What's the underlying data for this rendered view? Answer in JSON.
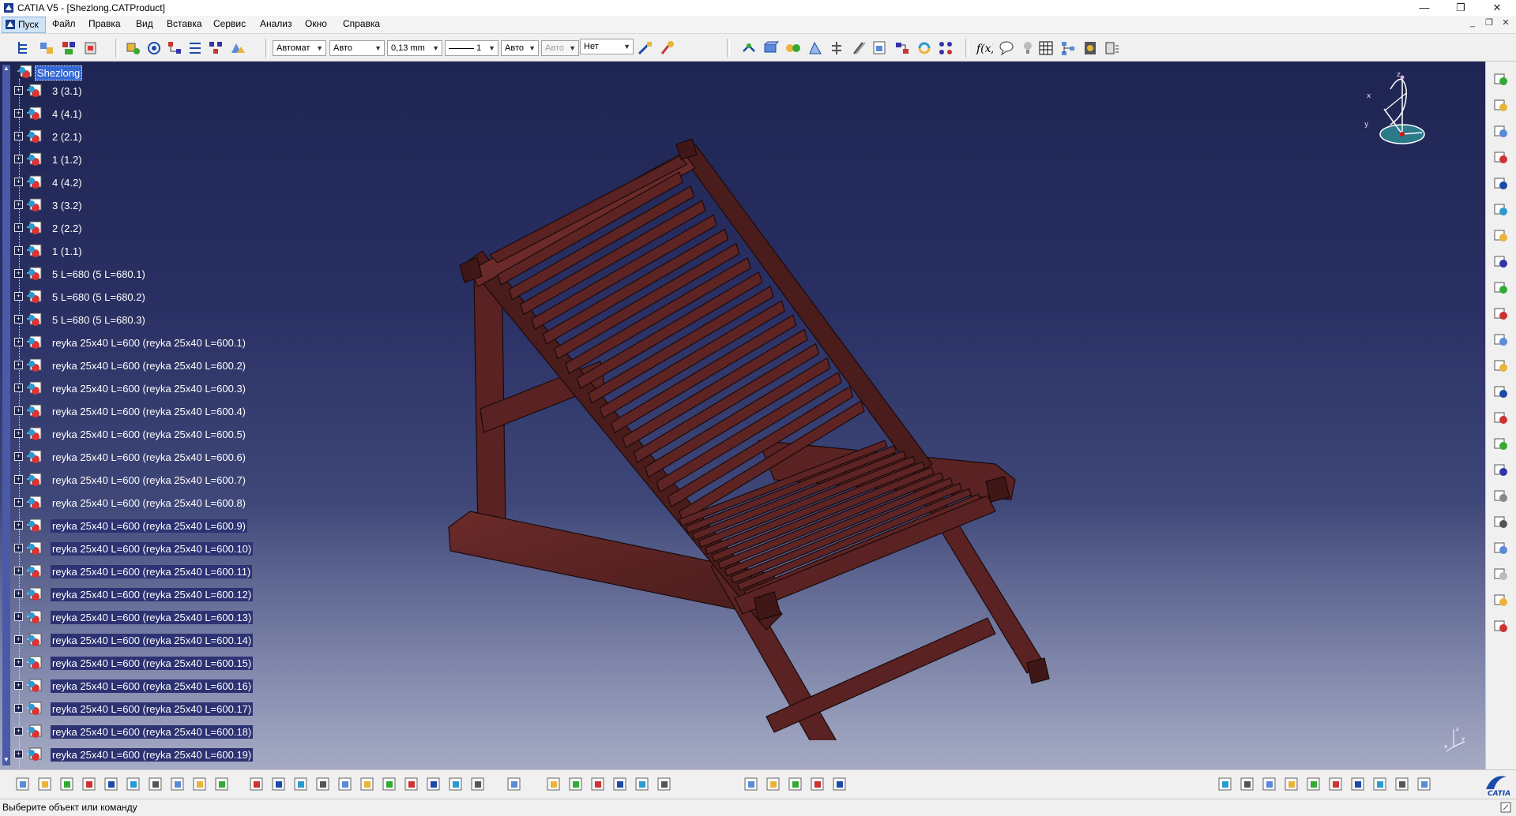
{
  "window": {
    "title": "CATIA V5 - [Shezlong.CATProduct]",
    "minimize": "—",
    "restore": "❐",
    "close": "✕"
  },
  "mdi": {
    "minimize": "_",
    "restore": "❐",
    "close": "✕"
  },
  "menu": {
    "start": "Пуск",
    "items": [
      "Файл",
      "Правка",
      "Вид",
      "Вставка",
      "Сервис",
      "Анализ",
      "Окно",
      "Справка"
    ]
  },
  "toolbar": {
    "color_combo": "Автомат",
    "transparency_combo": "Авто",
    "thickness_combo": "0,13 mm",
    "linetype_combo": "1",
    "point_combo": "Авто",
    "layer_combo_disabled": "Авто",
    "layer_combo": "Нет"
  },
  "tree": {
    "root": "Shezlong",
    "items": [
      "3 (3.1)",
      "4 (4.1)",
      "2 (2.1)",
      "1 (1.2)",
      "4 (4.2)",
      "3 (3.2)",
      "2 (2.2)",
      "1 (1.1)",
      "5 L=680 (5 L=680.1)",
      "5 L=680 (5 L=680.2)",
      "5 L=680 (5 L=680.3)",
      "reyka 25x40 L=600 (reyka 25x40 L=600.1)",
      "reyka 25x40 L=600 (reyka 25x40 L=600.2)",
      "reyka 25x40 L=600 (reyka 25x40 L=600.3)",
      "reyka 25x40 L=600 (reyka 25x40 L=600.4)",
      "reyka 25x40 L=600 (reyka 25x40 L=600.5)",
      "reyka 25x40 L=600 (reyka 25x40 L=600.6)",
      "reyka 25x40 L=600 (reyka 25x40 L=600.7)",
      "reyka 25x40 L=600 (reyka 25x40 L=600.8)",
      "reyka 25x40 L=600 (reyka 25x40 L=600.9)",
      "reyka 25x40 L=600 (reyka 25x40 L=600.10)",
      "reyka 25x40 L=600 (reyka 25x40 L=600.11)",
      "reyka 25x40 L=600 (reyka 25x40 L=600.12)",
      "reyka 25x40 L=600 (reyka 25x40 L=600.13)",
      "reyka 25x40 L=600 (reyka 25x40 L=600.14)",
      "reyka 25x40 L=600 (reyka 25x40 L=600.15)",
      "reyka 25x40 L=600 (reyka 25x40 L=600.16)",
      "reyka 25x40 L=600 (reyka 25x40 L=600.17)",
      "reyka 25x40 L=600 (reyka 25x40 L=600.18)",
      "reyka 25x40 L=600 (reyka 25x40 L=600.19)"
    ]
  },
  "compass": {
    "x": "x",
    "y": "y",
    "z": "z"
  },
  "status": {
    "text": "Выберите объект или команду"
  },
  "colors": {
    "chair": "#5a2222",
    "chair_edge": "#1a0a0a",
    "selection": "#3367d6",
    "viewport_top": "#1e2552"
  }
}
